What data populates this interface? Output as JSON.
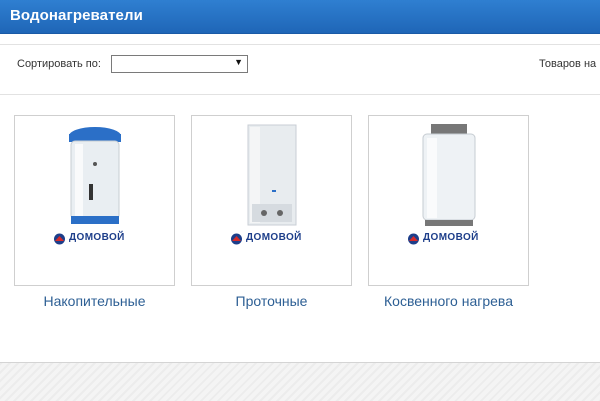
{
  "header": {
    "title": "Водонагреватели"
  },
  "toolbar": {
    "sort_label": "Сортировать по:",
    "sort_selected": "",
    "count_label": "Товаров на"
  },
  "categories": [
    {
      "title": "Накопительные",
      "brand": "ДОМОВОЙ",
      "icon": "storage-water-heater-icon"
    },
    {
      "title": "Проточные",
      "brand": "ДОМОВОЙ",
      "icon": "tankless-water-heater-icon"
    },
    {
      "title": "Косвенного нагрева",
      "brand": "ДОМОВОЙ",
      "icon": "indirect-water-heater-icon"
    }
  ],
  "colors": {
    "header_bg": "#1f66b7",
    "link": "#2d5f94",
    "brand": "#1d3e8a"
  }
}
